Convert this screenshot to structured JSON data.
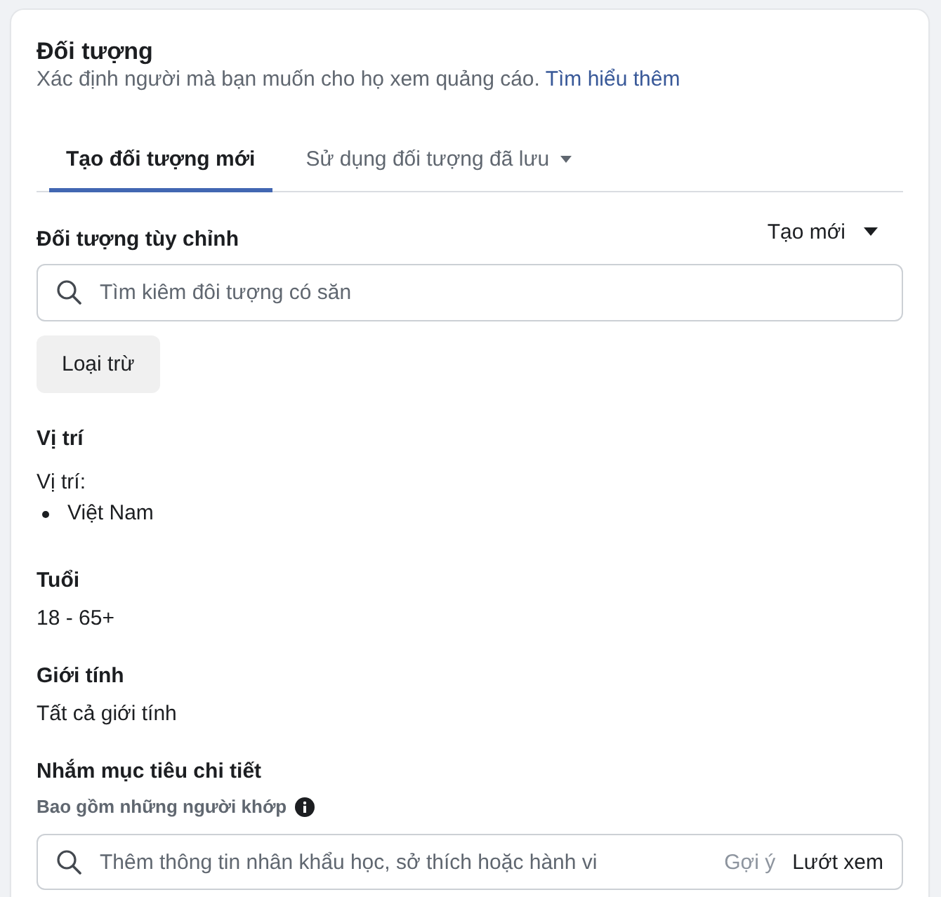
{
  "section": {
    "title": "Đối tượng",
    "description": "Xác định người mà bạn muốn cho họ xem quảng cáo.",
    "link": "Tìm hiểu thêm"
  },
  "tabs": [
    {
      "label": "Tạo đối tượng mới",
      "selected": true,
      "has_dropdown": false
    },
    {
      "label": "Sử dụng đối tượng đã lưu",
      "selected": false,
      "has_dropdown": true
    }
  ],
  "custom_audience": {
    "label": "Đối tượng tùy chỉnh",
    "create_button": "Tạo mới",
    "search": {
      "placeholder": "Tìm kiêm đôi tượng có săn"
    },
    "exclude_button": "Loại trừ"
  },
  "summary": [
    {
      "kind": "list",
      "label": "Vị trí",
      "heading": "Vị trí:",
      "items": [
        "Việt Nam"
      ]
    },
    {
      "kind": "value",
      "label": "Tuổi",
      "value": "18 - 65+"
    },
    {
      "kind": "value",
      "label": "Giới tính",
      "value": "Tất cả giới tính"
    }
  ],
  "detailed_targeting": {
    "label": "Nhắm mục tiêu chi tiết",
    "sublabel": "Bao gồm những người khớp",
    "search": {
      "placeholder": "Thêm thông tin nhân khẩu học, sở thích hoặc hành vi"
    },
    "suggestions_button": "Gợi ý",
    "browse_button": "Lướt xem"
  }
}
